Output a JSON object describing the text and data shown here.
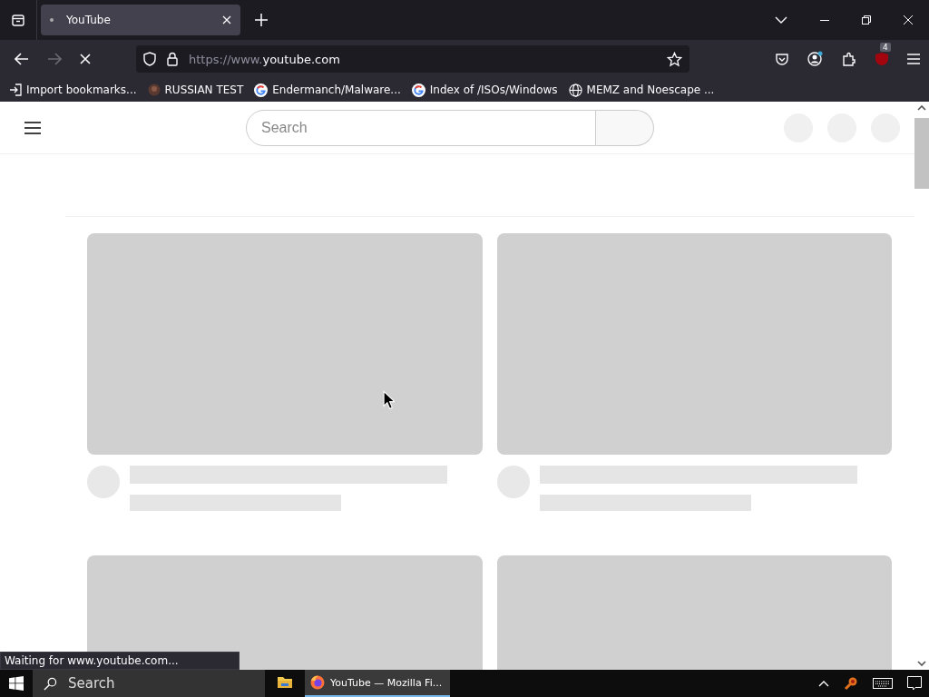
{
  "browser": {
    "tabs": [
      {
        "title": "YouTube",
        "selected": true,
        "loading": true
      }
    ],
    "url": {
      "prefix": "https://www.",
      "host": "youtube.com"
    },
    "extension_badge": "4",
    "bookmarks": [
      {
        "label": "Import bookmarks...",
        "kind": "import"
      },
      {
        "label": "RUSSIAN TEST",
        "kind": "avatar"
      },
      {
        "label": "Endermanch/Malware...",
        "kind": "google"
      },
      {
        "label": "Index of /ISOs/Windows",
        "kind": "google"
      },
      {
        "label": "MEMZ and Noescape ...",
        "kind": "globe"
      }
    ],
    "status": "Waiting for www.youtube.com..."
  },
  "page": {
    "search": {
      "placeholder": "Search"
    },
    "cards": [
      {
        "kind": "skeleton"
      },
      {
        "kind": "skeleton"
      },
      {
        "kind": "skeleton"
      },
      {
        "kind": "skeleton"
      }
    ]
  },
  "taskbar": {
    "search": {
      "placeholder": "Search"
    },
    "apps": [
      {
        "kind": "explorer",
        "selected": false
      },
      {
        "kind": "firefox",
        "label": "YouTube — Mozilla Fi...",
        "selected": true
      }
    ]
  }
}
